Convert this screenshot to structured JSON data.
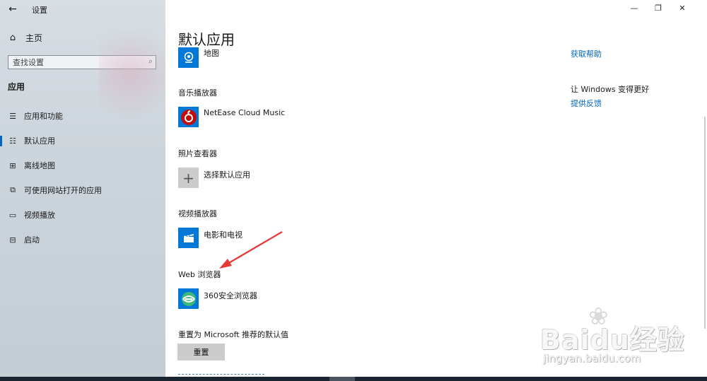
{
  "window": {
    "title": "设置",
    "back_icon": "←",
    "minimize": "—",
    "restore": "❐",
    "close": "✕"
  },
  "sidebar": {
    "home_label": "主页",
    "search_placeholder": "查找设置",
    "section": "应用",
    "items": [
      {
        "label": "应用和功能",
        "icon": "apps-list-icon",
        "glyph": "☰",
        "active": false
      },
      {
        "label": "默认应用",
        "icon": "default-apps-icon",
        "glyph": "☷",
        "active": true
      },
      {
        "label": "离线地图",
        "icon": "offline-map-icon",
        "glyph": "⊞",
        "active": false
      },
      {
        "label": "可使用网站打开的应用",
        "icon": "website-app-icon",
        "glyph": "⧉",
        "active": false
      },
      {
        "label": "视频播放",
        "icon": "video-playback-icon",
        "glyph": "▭",
        "active": false
      },
      {
        "label": "启动",
        "icon": "startup-icon",
        "glyph": "⊟",
        "active": false
      }
    ]
  },
  "main": {
    "title": "默认应用",
    "maps_app": "地图",
    "music_label": "音乐播放器",
    "music_app": "NetEase Cloud Music",
    "photo_label": "照片查看器",
    "photo_app": "选择默认应用",
    "video_label": "视频播放器",
    "video_app": "电影和电视",
    "web_label": "Web 浏览器",
    "web_app": "360安全浏览器",
    "reset_label": "重置为 Microsoft 推荐的默认值",
    "reset_button": "重置"
  },
  "right": {
    "help_link": "获取帮助",
    "improve_text": "让 Windows 变得更好",
    "feedback_link": "提供反馈"
  },
  "watermark": {
    "brand": "Baidu经验",
    "url": "jingyan.baidu.com"
  },
  "colors": {
    "accent": "#0067c0",
    "tile_blue": "#0078d7",
    "netease_red": "#c20c0c",
    "browser_green": "#3cb878",
    "tile_gray": "#cccccc",
    "annotation_red": "#e53935"
  }
}
